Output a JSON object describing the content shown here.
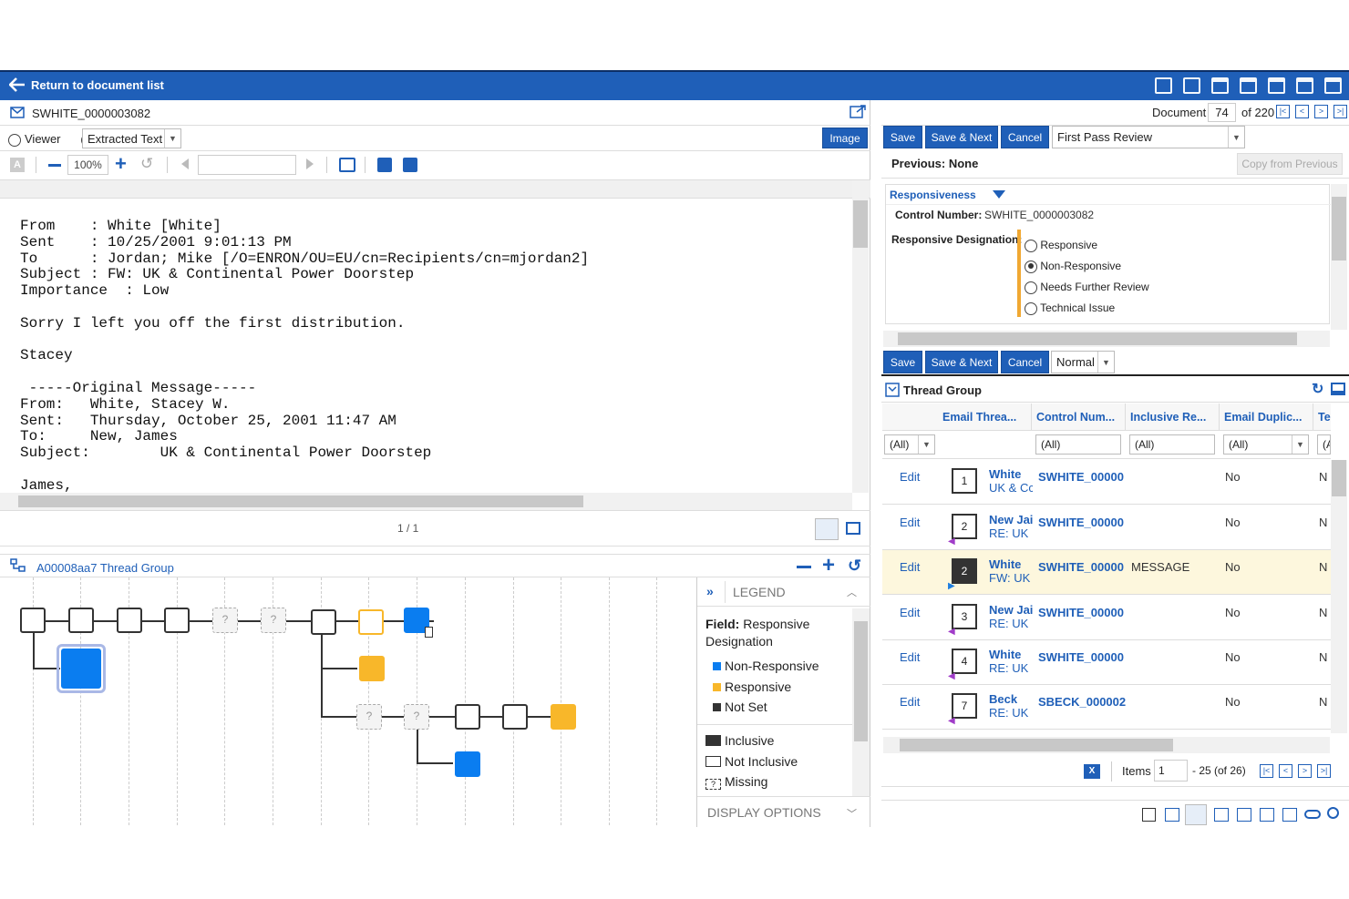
{
  "topbar": {
    "return_label": "Return to document list"
  },
  "document": {
    "filename": "SWHITE_0000003082",
    "viewer_label": "Viewer",
    "extracted_text_label": "Extracted Text",
    "image_button": "Image",
    "zoom": "100%",
    "page_indicator": "1 / 1",
    "text_lines": [
      "From    : White [White]",
      "Sent    : 10/25/2001 9:01:13 PM",
      "To      : Jordan; Mike [/O=ENRON/OU=EU/cn=Recipients/cn=mjordan2]",
      "Subject : FW: UK & Continental Power Doorstep",
      "Importance  : Low",
      "",
      "Sorry I left you off the first distribution.",
      "",
      "Stacey",
      "",
      " -----Original Message-----",
      "From:   White, Stacey W.",
      "Sent:   Thursday, October 25, 2001 11:47 AM",
      "To:     New, James",
      "Subject:        UK & Continental Power Doorstep",
      "",
      "James,"
    ]
  },
  "thread_panel": {
    "title": "A00008aa7 Thread Group",
    "legend_title": "LEGEND",
    "field_label": "Field:",
    "field_value": "Responsive Designation",
    "legend_items": [
      {
        "label": "Non-Responsive",
        "color": "#0a7df0"
      },
      {
        "label": "Responsive",
        "color": "#f8b72a"
      },
      {
        "label": "Not Set",
        "color": "#333333"
      }
    ],
    "shape_items": [
      "Inclusive",
      "Not Inclusive",
      "Missing"
    ],
    "display_options": "DISPLAY OPTIONS"
  },
  "review": {
    "document_label": "Document",
    "document_number": "74",
    "document_total": "of 220",
    "save": "Save",
    "save_next": "Save & Next",
    "cancel": "Cancel",
    "layout": "First Pass Review",
    "previous": "Previous: None",
    "copy_previous": "Copy from Previous",
    "section": "Responsiveness",
    "control_number_label": "Control Number:",
    "control_number": "SWHITE_0000003082",
    "designation_label": "Responsive Designation:",
    "designation_options": [
      "Responsive",
      "Non-Responsive",
      "Needs Further Review",
      "Technical Issue"
    ],
    "selected_option": "Non-Responsive",
    "mode": "Normal"
  },
  "thread_group": {
    "title": "Thread Group",
    "columns": [
      "Email Threa...",
      "Control Num...",
      "Inclusive Re...",
      "Email Duplic...",
      "Te"
    ],
    "filters": [
      "(All)",
      "(All)",
      "(All)",
      "(All)",
      "(A"
    ],
    "edit_label": "Edit",
    "rows": [
      {
        "num": "1",
        "from": "White",
        "subject": "UK & Cc",
        "control": "SWHITE_00000",
        "inclusive": "",
        "dup": "No",
        "last": "N"
      },
      {
        "num": "2",
        "from": "New Jai",
        "subject": "RE: UK",
        "control": "SWHITE_00000",
        "inclusive": "",
        "dup": "No",
        "last": "N"
      },
      {
        "num": "2",
        "from": "White",
        "subject": "FW: UK",
        "control": "SWHITE_00000",
        "inclusive": "MESSAGE",
        "dup": "No",
        "last": "N"
      },
      {
        "num": "3",
        "from": "New Jai",
        "subject": "RE: UK",
        "control": "SWHITE_00000",
        "inclusive": "",
        "dup": "No",
        "last": "N"
      },
      {
        "num": "4",
        "from": "White",
        "subject": "RE: UK",
        "control": "SWHITE_00000",
        "inclusive": "",
        "dup": "No",
        "last": "N"
      },
      {
        "num": "7",
        "from": "Beck",
        "subject": "RE: UK",
        "control": "SBECK_000002:",
        "inclusive": "",
        "dup": "No",
        "last": "N"
      }
    ],
    "items_label": "Items",
    "items_start": "1",
    "items_range": "- 25 (of 26)"
  }
}
